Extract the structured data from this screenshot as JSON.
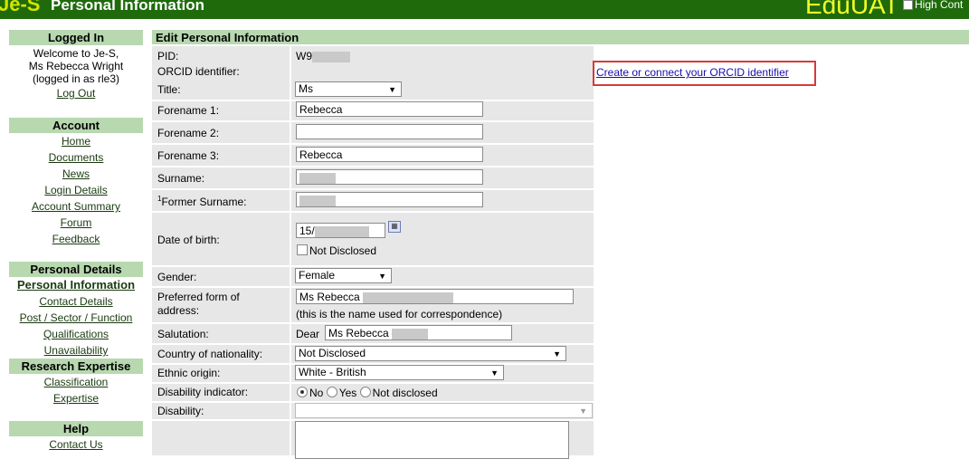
{
  "header": {
    "logo": "Je-S",
    "title": "Personal Information",
    "environment": "EduUAT",
    "high_contrast_label": "High Cont"
  },
  "sidebar": {
    "logged_in": {
      "heading": "Logged In",
      "welcome_lines": [
        "Welcome to Je-S,",
        "Ms Rebecca Wright",
        "(logged in as rle3)"
      ],
      "logout": "Log Out"
    },
    "account": {
      "heading": "Account",
      "items": [
        "Home",
        "Documents",
        "News",
        "Login Details",
        "Account Summary",
        "Forum",
        "Feedback"
      ]
    },
    "personal_details": {
      "heading": "Personal Details",
      "current": "Personal Information",
      "items": [
        "Contact Details",
        "Post / Sector / Function",
        "Qualifications",
        "Unavailability"
      ]
    },
    "research_expertise": {
      "heading": "Research Expertise",
      "items": [
        "Classification",
        "Expertise"
      ]
    },
    "help": {
      "heading": "Help",
      "items": [
        "Contact Us"
      ]
    }
  },
  "form": {
    "heading": "Edit Personal Information",
    "pid": {
      "label": "PID:",
      "value": "W9"
    },
    "orcid": {
      "label": "ORCID identifier:",
      "link": "Create or connect your ORCID identifier"
    },
    "title": {
      "label": "Title:",
      "value": "Ms"
    },
    "forename1": {
      "label": "Forename 1:",
      "value": "Rebecca"
    },
    "forename2": {
      "label": "Forename 2:",
      "value": ""
    },
    "forename3": {
      "label": "Forename 3:",
      "value": "Rebecca"
    },
    "surname": {
      "label": "Surname:",
      "value": ""
    },
    "former_surname": {
      "label": "Former Surname:",
      "note": "1",
      "value": ""
    },
    "dob": {
      "label": "Date of birth:",
      "value": "15/",
      "not_disclosed": "Not Disclosed"
    },
    "gender": {
      "label": "Gender:",
      "value": "Female"
    },
    "preferred": {
      "label_line1": "Preferred form of",
      "label_line2": "address:",
      "value": "Ms Rebecca",
      "note": "(this is the name used for correspondence)"
    },
    "salutation": {
      "label": "Salutation:",
      "prefix": "Dear",
      "value": "Ms Rebecca"
    },
    "nationality": {
      "label": "Country of nationality:",
      "value": "Not Disclosed"
    },
    "ethnic": {
      "label": "Ethnic origin:",
      "value": "White - British"
    },
    "disability_indicator": {
      "label": "Disability indicator:",
      "options": [
        "No",
        "Yes",
        "Not disclosed"
      ],
      "selected": "No"
    },
    "disability": {
      "label": "Disability:",
      "value": ""
    }
  }
}
